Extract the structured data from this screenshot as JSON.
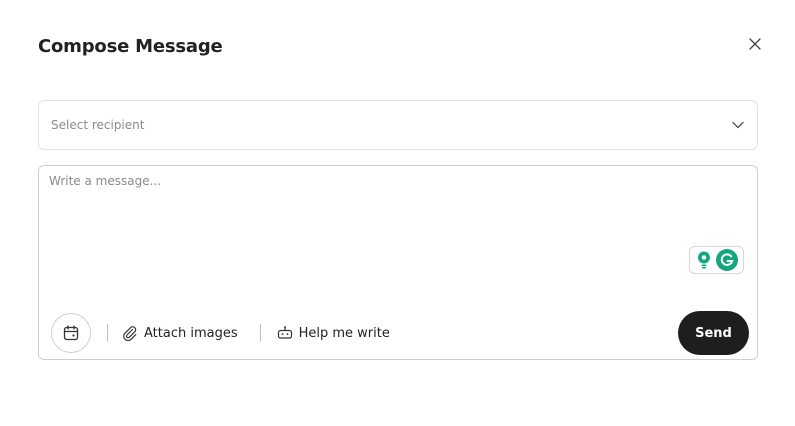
{
  "dialog": {
    "title": "Compose Message",
    "close_icon": "close-icon"
  },
  "recipient": {
    "placeholder": "Select recipient",
    "icon": "chevron-down-icon"
  },
  "message": {
    "placeholder": "Write a message...",
    "value": ""
  },
  "toolbar": {
    "schedule_icon": "calendar-icon",
    "attach_label": "Attach images",
    "attach_icon": "paperclip-icon",
    "help_label": "Help me write",
    "help_icon": "robot-icon",
    "send_label": "Send"
  },
  "colors": {
    "send_bg": "#1e1e1e",
    "grammarly_green": "#15a680",
    "border": "#cfcfcf"
  }
}
